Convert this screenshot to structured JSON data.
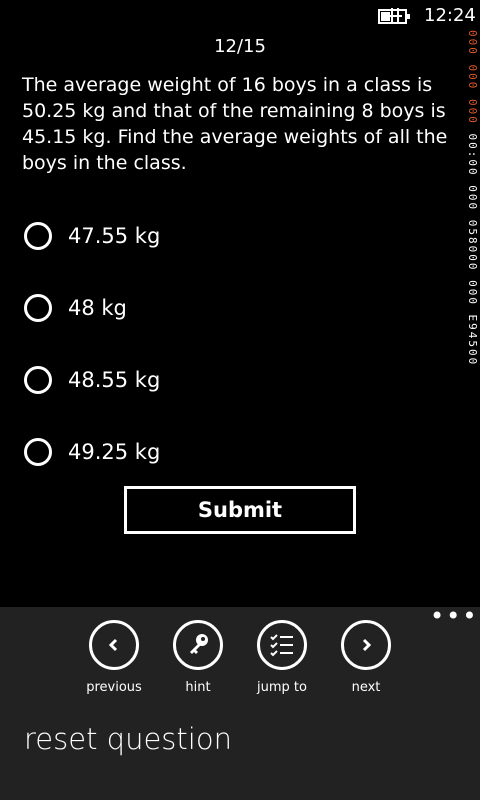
{
  "status": {
    "time": "12:24"
  },
  "side_readout": {
    "red": "000 000 000",
    "white": "00:00 000 058000 000 E94500"
  },
  "header": {
    "counter": "12/15"
  },
  "question": {
    "text": "The average weight of 16 boys in a class is 50.25 kg and that of the remaining 8 boys is 45.15 kg. Find the average weights of all the boys in the class."
  },
  "options": [
    {
      "label": "47.55 kg",
      "selected": false
    },
    {
      "label": "48 kg",
      "selected": false
    },
    {
      "label": "48.55 kg",
      "selected": false
    },
    {
      "label": "49.25 kg",
      "selected": false
    }
  ],
  "submit": {
    "label": "Submit"
  },
  "app_bar": {
    "buttons": [
      {
        "label": "previous",
        "icon": "chevron-left-icon"
      },
      {
        "label": "hint",
        "icon": "key-icon"
      },
      {
        "label": "jump to",
        "icon": "checklist-icon"
      },
      {
        "label": "next",
        "icon": "chevron-right-icon"
      }
    ],
    "menu_item": "reset question",
    "more": "•••"
  }
}
